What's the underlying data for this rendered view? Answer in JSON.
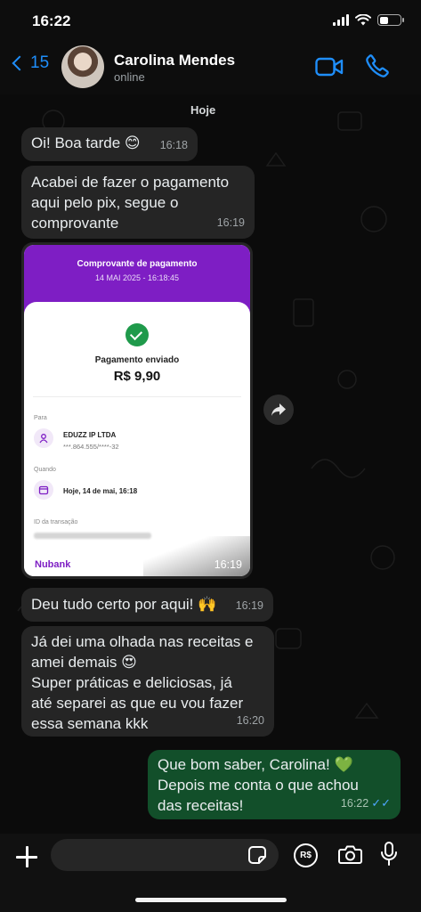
{
  "status_bar": {
    "time": "16:22"
  },
  "header": {
    "back_count": "15",
    "contact_name": "Carolina Mendes",
    "contact_status": "online"
  },
  "chat": {
    "day_label": "Hoje",
    "messages": [
      {
        "text": "Oi! Boa tarde 😊",
        "time": "16:18"
      },
      {
        "text": "Acabei de fazer o pagamento\naqui pelo pix, segue o\ncomprovante",
        "time": "16:19"
      },
      {
        "text": "Deu tudo certo por aqui! 🙌",
        "time": "16:19"
      },
      {
        "text": "Já dei uma olhada nas receitas e\namei demais 😍\nSuper práticas e deliciosas, já\naté separei as que eu vou fazer\nessa semana kkk",
        "time": "16:20"
      },
      {
        "text": "Que bom saber, Carolina! 💚\nDepois me conta o que achou\ndas receitas!",
        "time": "16:22",
        "ticks": "✓✓"
      }
    ],
    "receipt": {
      "title": "Comprovante de pagamento",
      "date": "14 MAI 2025 - 16:18:45",
      "status": "Pagamento enviado",
      "amount": "R$ 9,90",
      "to_label": "Para",
      "to_name": "EDUZZ IP LTDA",
      "to_doc": "***.864.555/****-32",
      "when_label": "Quando",
      "when_value": "Hoje, 14 de mai, 16:18",
      "id_label": "ID da transação",
      "brand": "Nubank",
      "time": "16:19"
    }
  },
  "composer": {
    "pay_label": "R$"
  },
  "colors": {
    "accent": "#1f8efa",
    "outgoing_bubble": "#124f2a",
    "incoming_bubble": "#252525",
    "nubank_purple": "#7e1ec4"
  }
}
